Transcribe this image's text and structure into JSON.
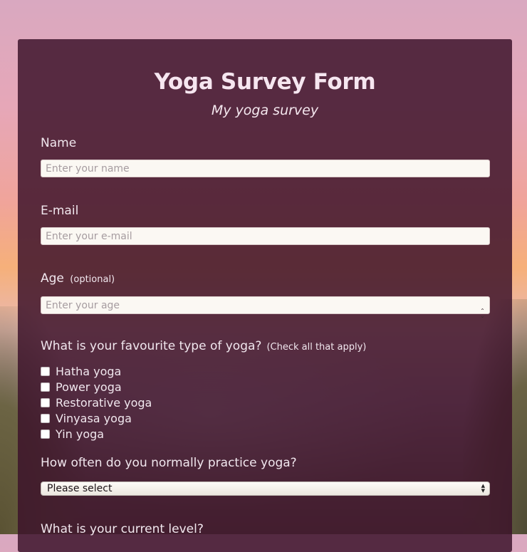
{
  "form": {
    "title": "Yoga Survey Form",
    "subtitle": "My yoga survey"
  },
  "name": {
    "label": "Name",
    "placeholder": "Enter your name"
  },
  "email": {
    "label": "E-mail",
    "placeholder": "Enter your e-mail"
  },
  "age": {
    "label": "Age",
    "hint": "(optional)",
    "placeholder": "Enter your age"
  },
  "yoga_types": {
    "question": "What is your favourite type of yoga?",
    "hint": "(Check all that apply)",
    "options": [
      {
        "label": "Hatha yoga",
        "checked": false
      },
      {
        "label": "Power yoga",
        "checked": false
      },
      {
        "label": "Restorative yoga",
        "checked": false
      },
      {
        "label": "Vinyasa yoga",
        "checked": false
      },
      {
        "label": "Yin yoga",
        "checked": false
      }
    ]
  },
  "frequency": {
    "question": "How often do you normally practice yoga?",
    "selected": "Please select"
  },
  "level": {
    "question": "What is your current level?"
  },
  "colors": {
    "card_background": "#3c122a",
    "title_text": "#f6e6f0",
    "field_background": "#fbf8f3"
  },
  "icons": {
    "number_spinner": "spinner-icon",
    "select_arrows": "select-arrows-icon"
  }
}
